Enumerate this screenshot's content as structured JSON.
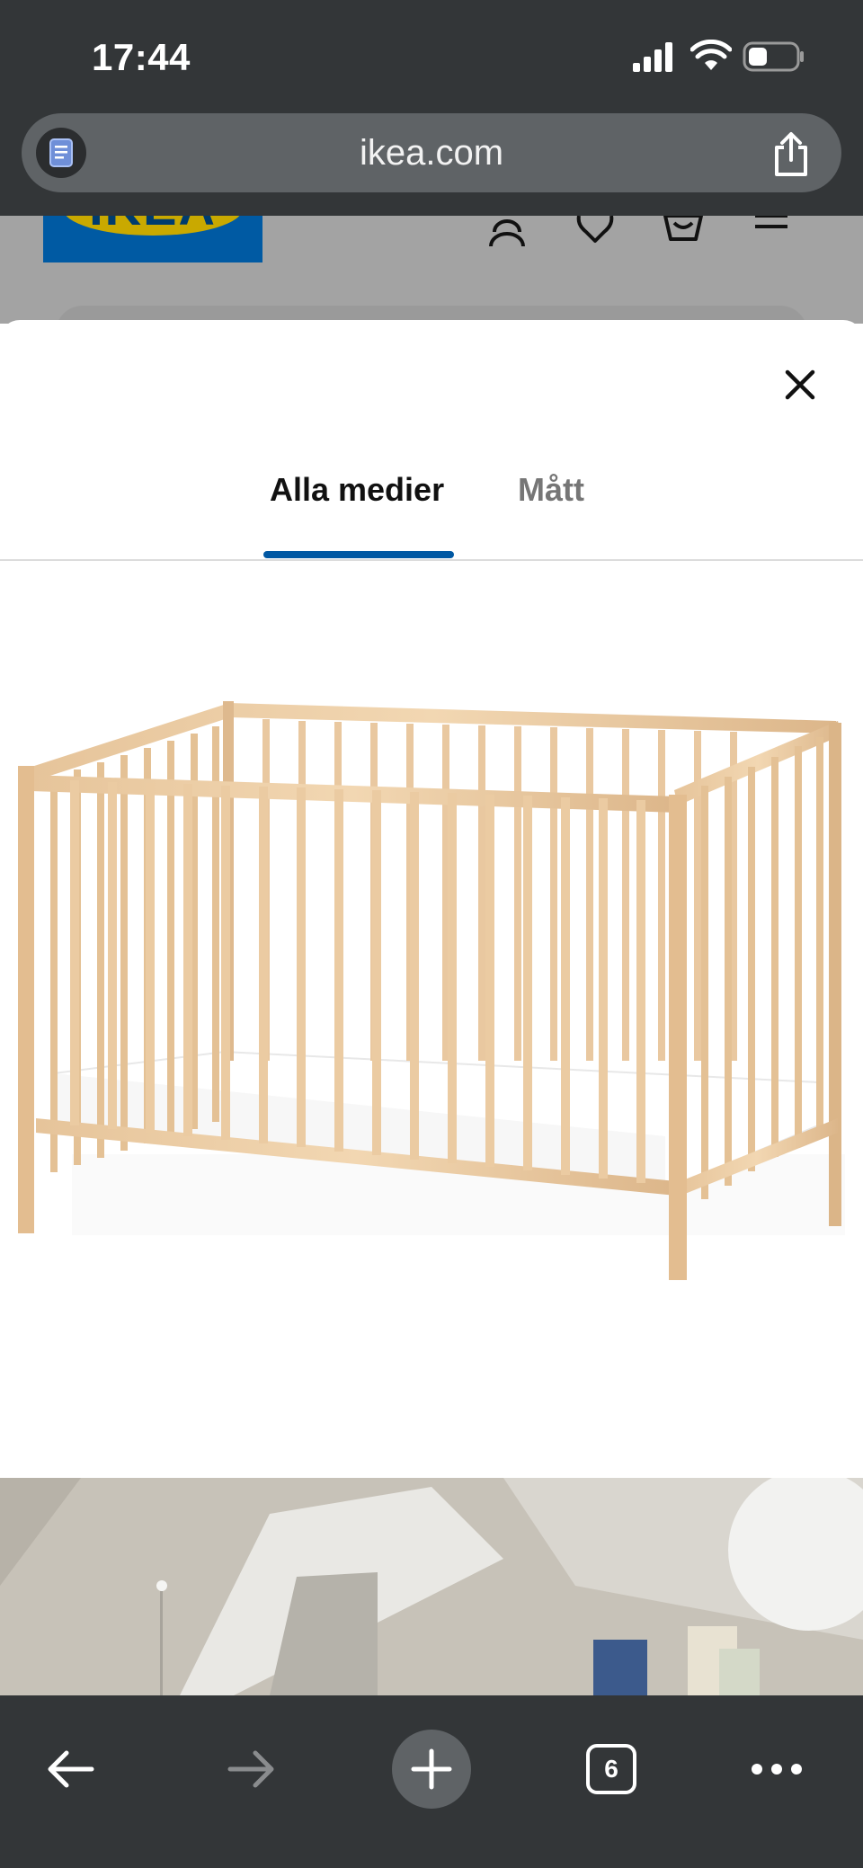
{
  "status_bar": {
    "time": "17:44",
    "signal_icon": "cellular-signal-icon",
    "wifi_icon": "wifi-icon",
    "battery_icon": "battery-icon",
    "battery_level": 0.35
  },
  "browser": {
    "url": "ikea.com",
    "reader_icon": "reader-mode-icon",
    "share_icon": "share-icon"
  },
  "background_page": {
    "logo_text": "IKEA",
    "header_icons": [
      "account-icon",
      "wishlist-heart-icon",
      "cart-icon",
      "menu-icon"
    ]
  },
  "modal": {
    "close_icon": "close-icon",
    "tabs": [
      {
        "label": "Alla medier",
        "active": true
      },
      {
        "label": "Mått",
        "active": false
      }
    ]
  },
  "toolbar": {
    "tabs_count": "6",
    "icons": [
      "back-arrow-icon",
      "forward-arrow-icon",
      "new-tab-plus-icon",
      "tabs-icon",
      "more-dots-icon"
    ]
  },
  "colors": {
    "browser_chrome": "#333638",
    "url_pill": "#5f6366",
    "tab_indicator": "#0058a3",
    "ikea_blue": "#005aa3",
    "ikea_yellow": "#c9a900"
  }
}
